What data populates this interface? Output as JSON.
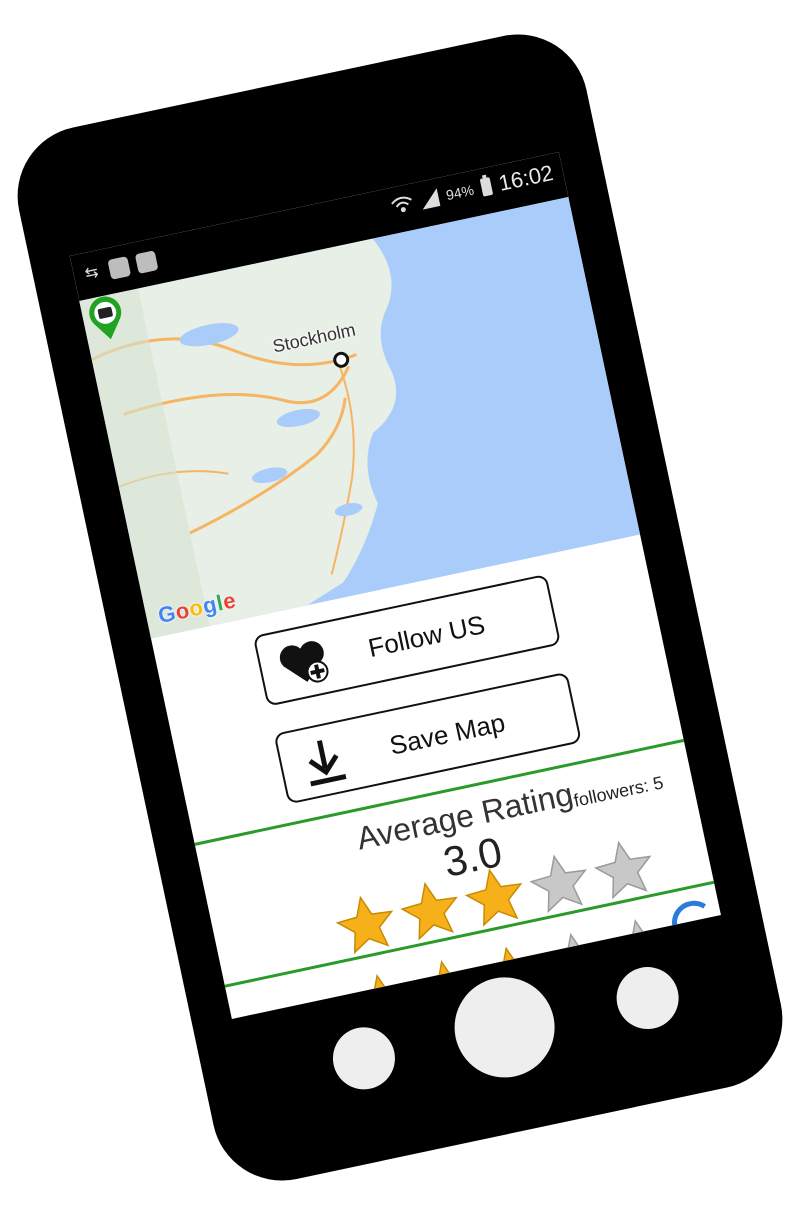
{
  "status_bar": {
    "battery_text": "94%",
    "time": "16:02",
    "icons": [
      "sync-icon",
      "screenshot-icon",
      "no-sync-icon",
      "wifi-icon",
      "signal-icon",
      "battery-charging-icon"
    ]
  },
  "map": {
    "city_label": "Stockholm",
    "attribution": {
      "g1": "G",
      "o1": "o",
      "o2": "o",
      "g2": "g",
      "l": "l",
      "e": "e"
    },
    "pin_icon": "map-pin-icon",
    "water_color": "#a9ccfb",
    "land_color": "#e8efe6",
    "pin_color": "#21a321"
  },
  "actions": {
    "follow_label": "Follow US",
    "follow_icon": "heart-plus-icon",
    "save_label": "Save  Map",
    "save_icon": "download-icon"
  },
  "rating": {
    "title": "Average Rating",
    "followers_text": "followers: 5",
    "value_text": "3.0",
    "stars_filled": 3,
    "stars_total": 5
  },
  "second_rating": {
    "stars_filled": 3,
    "stars_total": 5
  },
  "colors": {
    "divider": "#2a9a2a",
    "star_filled": "#f6b11a",
    "star_empty": "#c8c8c8",
    "phone": "#000000"
  }
}
